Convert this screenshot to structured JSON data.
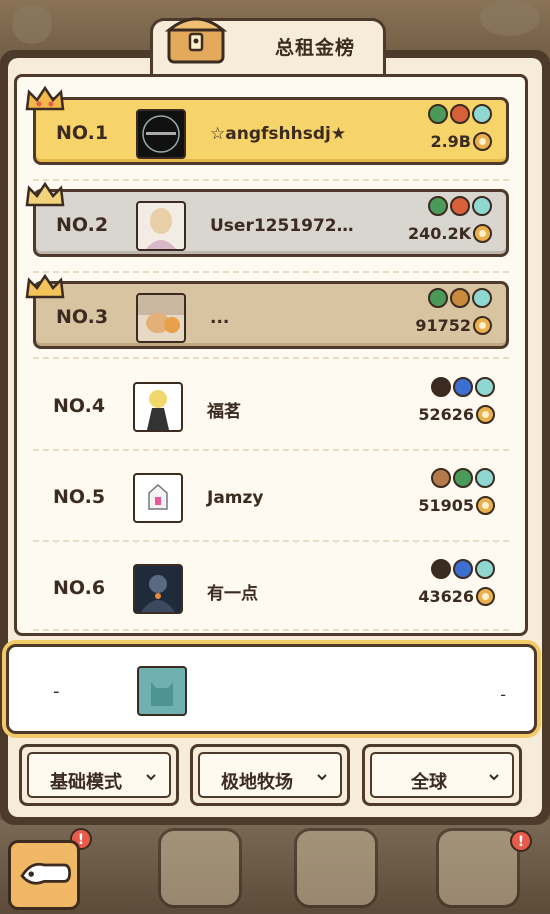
{
  "header": {
    "title": "总租金榜"
  },
  "leaderboard": [
    {
      "rank": "NO.1",
      "name": "☆angfshhsdj★",
      "score": "2.9B",
      "badges": [
        "#4c9a5a",
        "#d8603b",
        "#8fd8d2"
      ]
    },
    {
      "rank": "NO.2",
      "name": "User1251972…",
      "score": "240.2K",
      "badges": [
        "#4c9a5a",
        "#d8603b",
        "#8fd8d2"
      ]
    },
    {
      "rank": "NO.3",
      "name": "...",
      "score": "91752",
      "badges": [
        "#4c9a5a",
        "#c98a3b",
        "#8fd8d2"
      ]
    },
    {
      "rank": "NO.4",
      "name": "福茗",
      "score": "52626",
      "badges": [
        "#3b2b20",
        "#3b6fd0",
        "#8fd8d2"
      ]
    },
    {
      "rank": "NO.5",
      "name": "Jamzy",
      "score": "51905",
      "badges": [
        "#b57a4a",
        "#4c9a5a",
        "#8fd8d2"
      ]
    },
    {
      "rank": "NO.6",
      "name": "有一点",
      "score": "43626",
      "badges": [
        "#3b2b20",
        "#3b6fd0",
        "#8fd8d2"
      ]
    }
  ],
  "me": {
    "rank": "-",
    "score": "-"
  },
  "filters": [
    {
      "label": "基础模式"
    },
    {
      "label": "极地牧场"
    },
    {
      "label": "全球"
    }
  ],
  "colors": {
    "gold_row": "#f7d46a",
    "silver_row": "#d9d5cf",
    "bronze_row": "#d9c4a2",
    "panel": "#4d3a2a"
  }
}
